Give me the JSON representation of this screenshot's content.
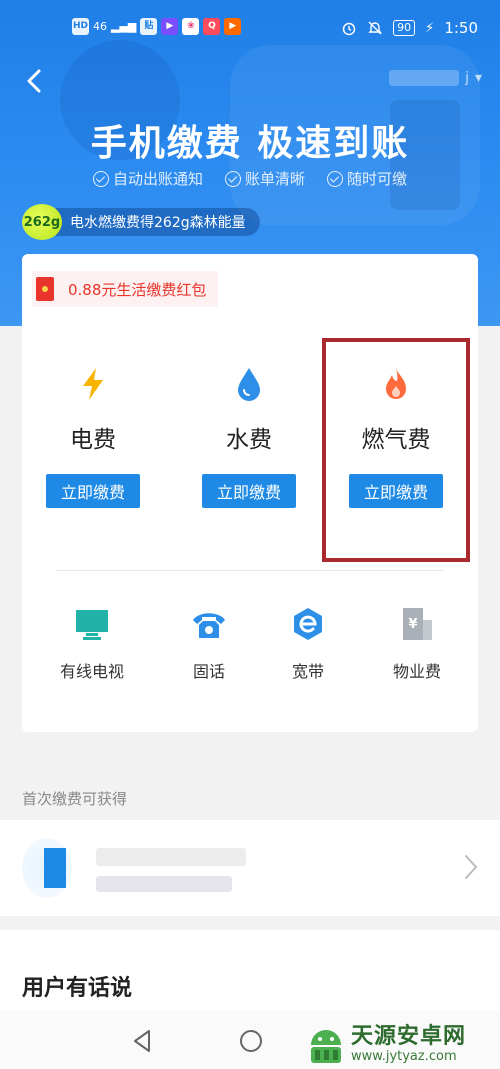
{
  "status_bar": {
    "left_icons": [
      "HD",
      "46",
      "贴",
      "▶",
      "❀",
      "Q",
      "▶"
    ],
    "battery": "90",
    "time": "1:50"
  },
  "header": {
    "account_suffix": "j",
    "title": "手机缴费 极速到账",
    "features": [
      "自动出账通知",
      "账单清晰",
      "随时可缴"
    ],
    "energy_badge": "262g",
    "energy_text": "电水燃缴费得262g森林能量"
  },
  "promo": {
    "red_packet": "0.88元生活缴费红包"
  },
  "main_bills": [
    {
      "label": "电费",
      "button": "立即缴费",
      "icon": "lightning-icon",
      "color": "#f7b500"
    },
    {
      "label": "水费",
      "button": "立即缴费",
      "icon": "water-drop-icon",
      "color": "#2d8fe8"
    },
    {
      "label": "燃气费",
      "button": "立即缴费",
      "icon": "flame-icon",
      "color": "#ff6a3d"
    }
  ],
  "sub_bills": [
    {
      "label": "有线电视",
      "icon": "tv-icon"
    },
    {
      "label": "固话",
      "icon": "telephone-icon"
    },
    {
      "label": "宽带",
      "icon": "broadband-icon"
    },
    {
      "label": "物业费",
      "icon": "property-building-icon"
    }
  ],
  "first_payment": {
    "title": "首次缴费可获得"
  },
  "user_talk": {
    "title": "用户有话说"
  },
  "watermark": {
    "title": "天源安卓网",
    "url": "www.jytyaz.com"
  },
  "colors": {
    "accent": "#1e8ae6",
    "highlight": "#a82a2e",
    "red": "#e8342a"
  }
}
